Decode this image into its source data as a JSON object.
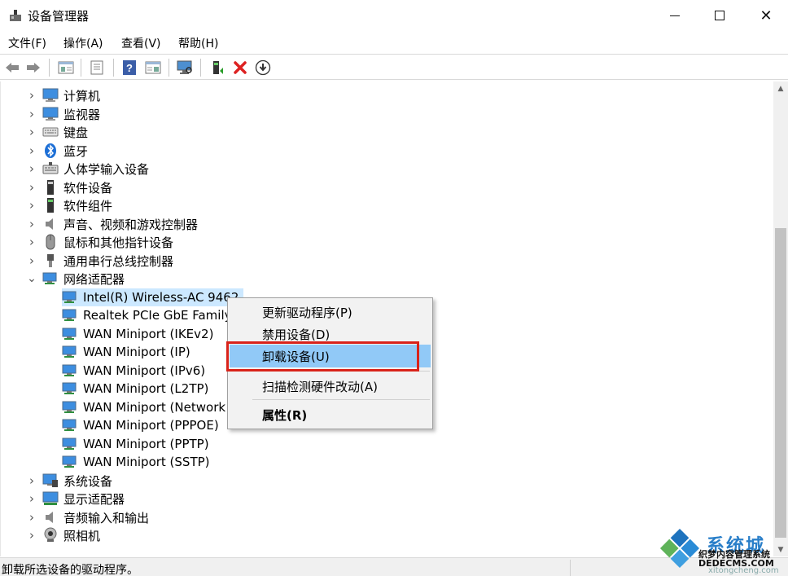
{
  "window": {
    "title": "设备管理器"
  },
  "menu": [
    {
      "label": "文件(F)"
    },
    {
      "label": "操作(A)"
    },
    {
      "label": "查看(V)"
    },
    {
      "label": "帮助(H)"
    }
  ],
  "toolbar": {
    "icons": [
      "back-icon",
      "forward-icon",
      "properties-pane-icon",
      "device-list-icon",
      "help-icon",
      "view-icon",
      "scan-hardware-icon",
      "update-driver-icon",
      "uninstall-icon",
      "download-icon"
    ]
  },
  "tree": {
    "categories_top": [
      {
        "label": "计算机",
        "icon": "computer-icon"
      },
      {
        "label": "监视器",
        "icon": "monitor-icon"
      },
      {
        "label": "键盘",
        "icon": "keyboard-icon"
      },
      {
        "label": "蓝牙",
        "icon": "bluetooth-icon"
      },
      {
        "label": "人体学输入设备",
        "icon": "hid-icon"
      },
      {
        "label": "软件设备",
        "icon": "software-device-icon"
      },
      {
        "label": "软件组件",
        "icon": "software-component-icon"
      },
      {
        "label": "声音、视频和游戏控制器",
        "icon": "speaker-icon"
      },
      {
        "label": "鼠标和其他指针设备",
        "icon": "mouse-icon"
      },
      {
        "label": "通用串行总线控制器",
        "icon": "usb-icon"
      }
    ],
    "expanded_category": {
      "label": "网络适配器",
      "icon": "network-adapter-icon"
    },
    "network_children": [
      {
        "label": "Intel(R) Wireless-AC 9462"
      },
      {
        "label": "Realtek PCIe GbE Family C"
      },
      {
        "label": "WAN Miniport (IKEv2)"
      },
      {
        "label": "WAN Miniport (IP)"
      },
      {
        "label": "WAN Miniport (IPv6)"
      },
      {
        "label": "WAN Miniport (L2TP)"
      },
      {
        "label": "WAN Miniport (Network M"
      },
      {
        "label": "WAN Miniport (PPPOE)"
      },
      {
        "label": "WAN Miniport (PPTP)"
      },
      {
        "label": "WAN Miniport (SSTP)"
      }
    ],
    "categories_bottom": [
      {
        "label": "系统设备",
        "icon": "system-device-icon"
      },
      {
        "label": "显示适配器",
        "icon": "display-adapter-icon"
      },
      {
        "label": "音频输入和输出",
        "icon": "audio-io-icon"
      },
      {
        "label": "照相机",
        "icon": "camera-icon"
      }
    ]
  },
  "context_menu": {
    "items": [
      {
        "label": "更新驱动程序(P)"
      },
      {
        "label": "禁用设备(D)"
      },
      {
        "label": "卸载设备(U)"
      },
      {
        "label": "扫描检测硬件改动(A)"
      },
      {
        "label": "属性(R)"
      }
    ]
  },
  "status": {
    "text": "卸载所选设备的驱动程序。"
  },
  "watermark": {
    "line1": "系统城",
    "line2": "织梦内容管理系统",
    "line3": "DEDECMS.COM",
    "line4": "xitongcheng.com"
  },
  "colors": {
    "selection": "#cce8ff",
    "menu_highlight": "#91c9f7",
    "annotation_red": "#d9231a"
  }
}
